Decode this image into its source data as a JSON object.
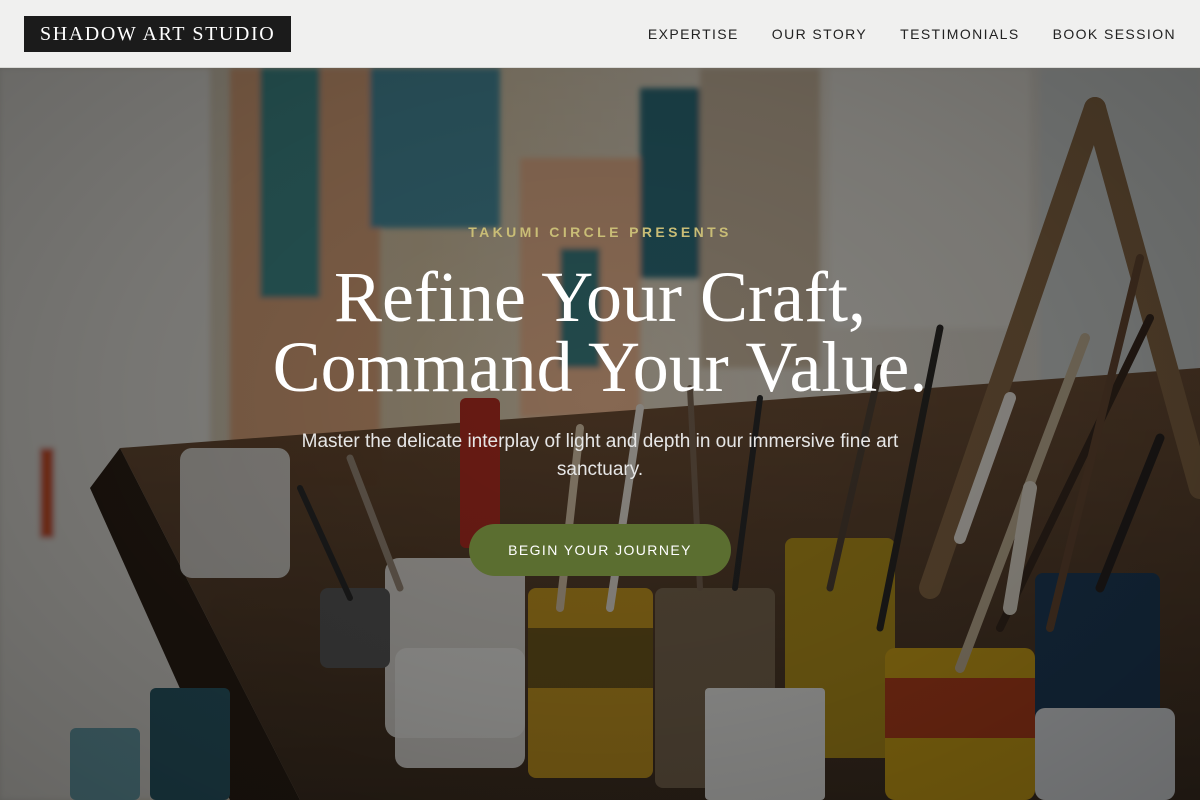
{
  "header": {
    "logo": "SHADOW ART STUDIO",
    "nav": [
      {
        "label": "EXPERTISE"
      },
      {
        "label": "OUR STORY"
      },
      {
        "label": "TESTIMONIALS"
      },
      {
        "label": "BOOK SESSION"
      }
    ]
  },
  "hero": {
    "eyebrow": "TAKUMI CIRCLE PRESENTS",
    "headline_line1": "Refine Your Craft,",
    "headline_line2": "Command Your Value.",
    "subtitle": "Master the delicate interplay of light and depth in our immersive fine art sanctuary.",
    "cta_label": "BEGIN YOUR JOURNEY"
  },
  "colors": {
    "accent_gold": "#c9bd76",
    "cta_green": "#5b6e30",
    "logo_bg": "#1b1b1b",
    "header_bg": "#f0f0ef"
  }
}
